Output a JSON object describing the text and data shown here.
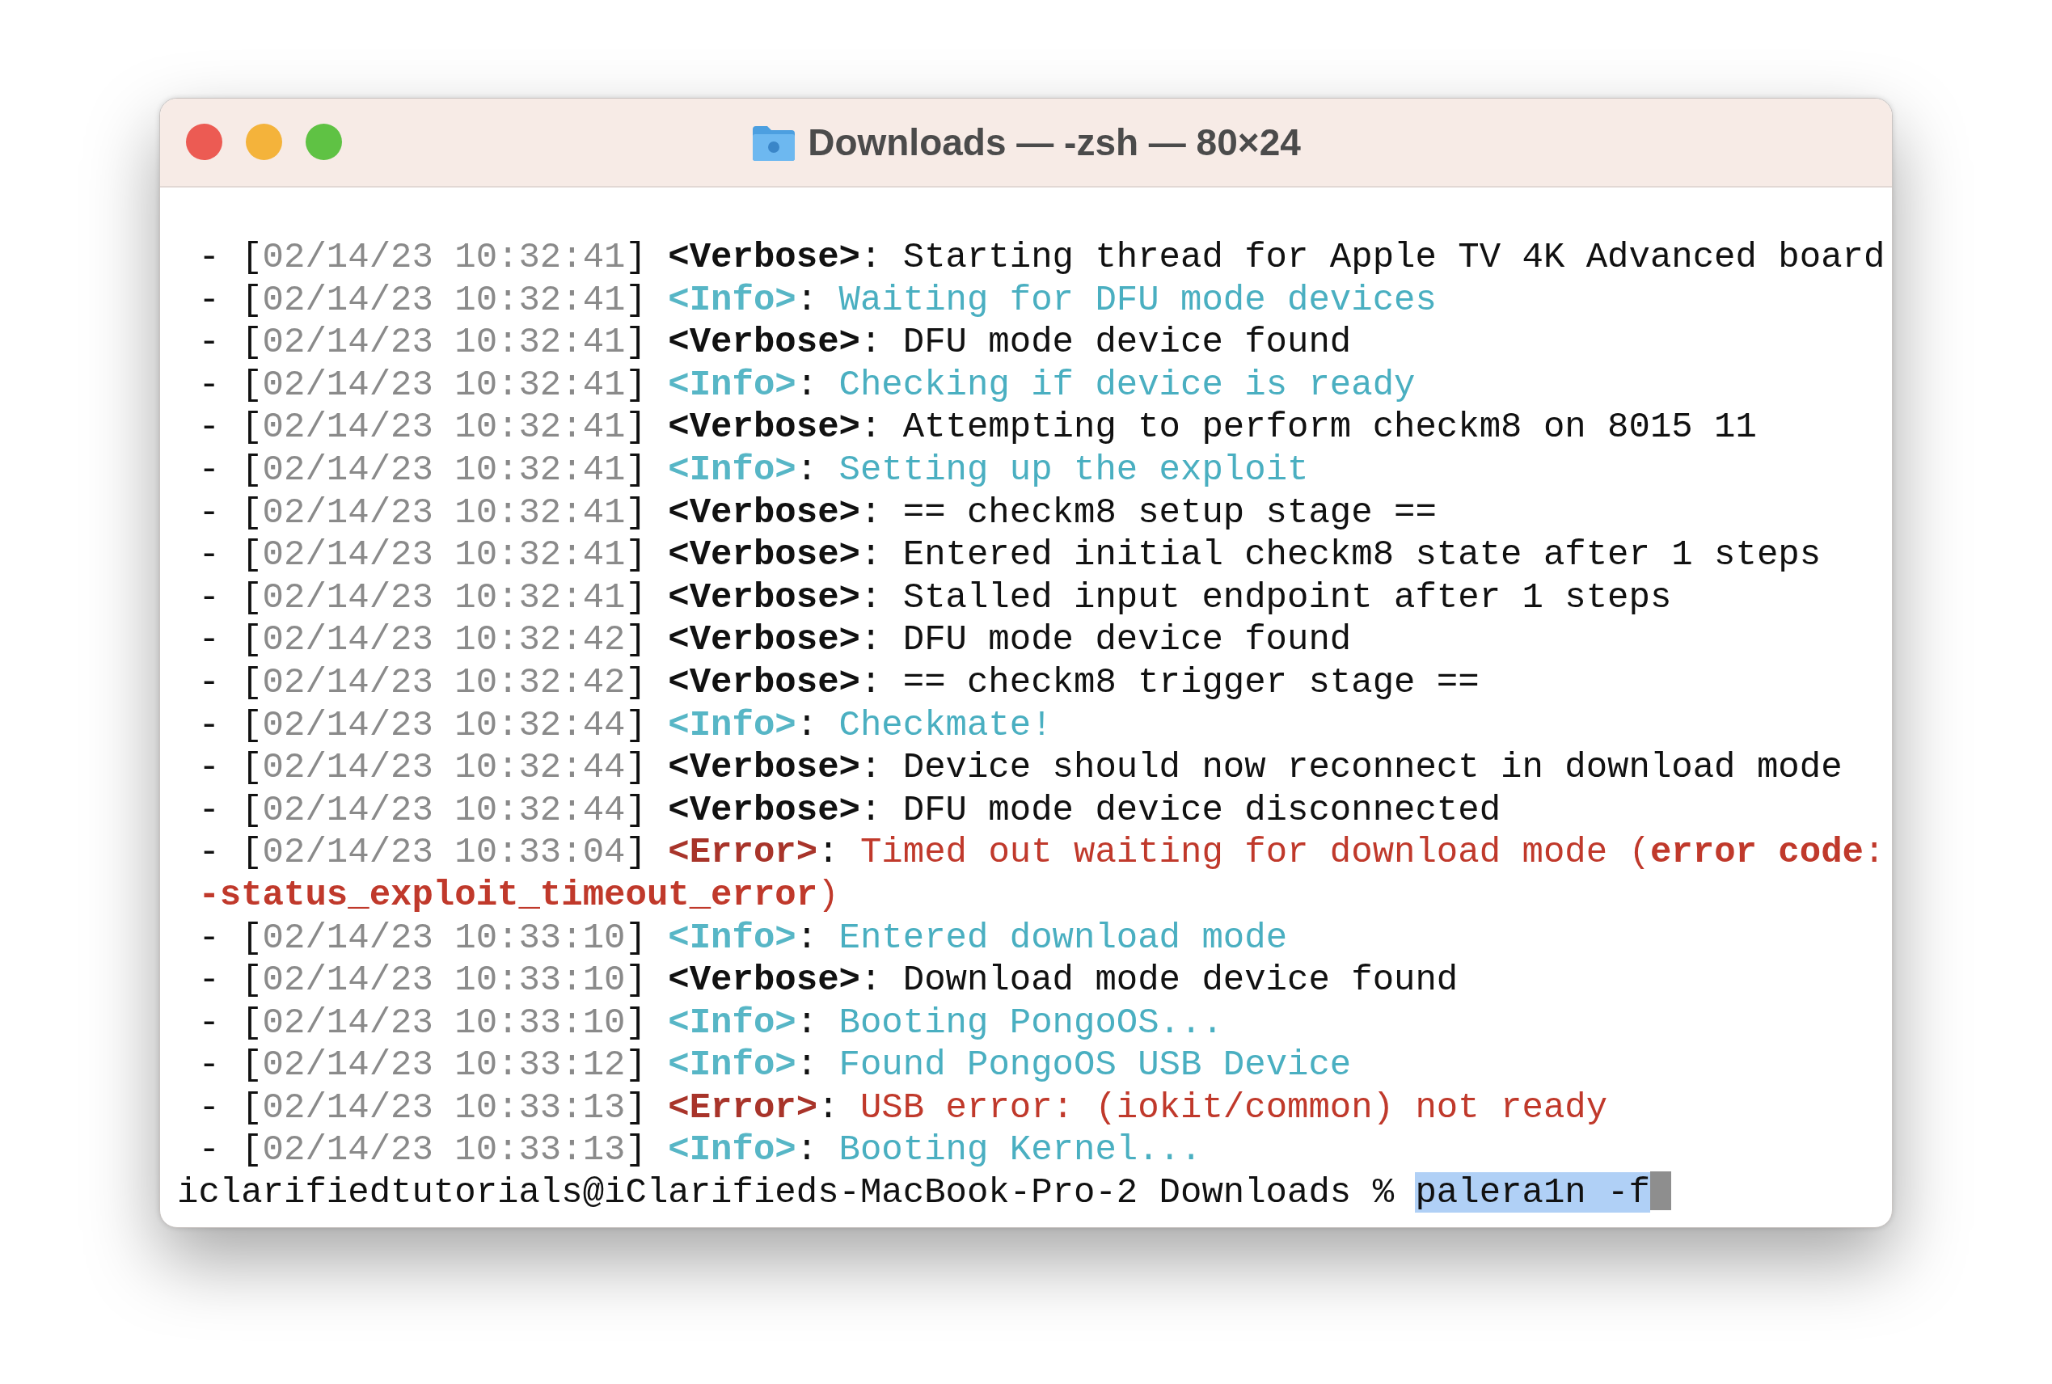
{
  "window": {
    "title": "Downloads — -zsh — 80×24"
  },
  "log": [
    {
      "kind": "verbose",
      "dash": "-",
      "timestamp": "[02/14/23 10:32:41]",
      "tag": "<Verbose>:",
      "message": "Starting thread for Apple TV 4K Advanced board"
    },
    {
      "kind": "info",
      "dash": "-",
      "timestamp": "[02/14/23 10:32:41]",
      "tag": "<Info>:",
      "message": "Waiting for DFU mode devices"
    },
    {
      "kind": "verbose",
      "dash": "-",
      "timestamp": "[02/14/23 10:32:41]",
      "tag": "<Verbose>:",
      "message": "DFU mode device found"
    },
    {
      "kind": "info",
      "dash": "-",
      "timestamp": "[02/14/23 10:32:41]",
      "tag": "<Info>:",
      "message": "Checking if device is ready"
    },
    {
      "kind": "verbose",
      "dash": "-",
      "timestamp": "[02/14/23 10:32:41]",
      "tag": "<Verbose>:",
      "message": "Attempting to perform checkm8 on 8015 11"
    },
    {
      "kind": "info",
      "dash": "-",
      "timestamp": "[02/14/23 10:32:41]",
      "tag": "<Info>:",
      "message": "Setting up the exploit"
    },
    {
      "kind": "verbose",
      "dash": "-",
      "timestamp": "[02/14/23 10:32:41]",
      "tag": "<Verbose>:",
      "message": "== checkm8 setup stage =="
    },
    {
      "kind": "verbose",
      "dash": "-",
      "timestamp": "[02/14/23 10:32:41]",
      "tag": "<Verbose>:",
      "message": "Entered initial checkm8 state after 1 steps"
    },
    {
      "kind": "verbose",
      "dash": "-",
      "timestamp": "[02/14/23 10:32:41]",
      "tag": "<Verbose>:",
      "message": "Stalled input endpoint after 1 steps"
    },
    {
      "kind": "verbose",
      "dash": "-",
      "timestamp": "[02/14/23 10:32:42]",
      "tag": "<Verbose>:",
      "message": "DFU mode device found"
    },
    {
      "kind": "verbose",
      "dash": "-",
      "timestamp": "[02/14/23 10:32:42]",
      "tag": "<Verbose>:",
      "message": "== checkm8 trigger stage =="
    },
    {
      "kind": "info",
      "dash": "-",
      "timestamp": "[02/14/23 10:32:44]",
      "tag": "<Info>:",
      "message": "Checkmate!"
    },
    {
      "kind": "verbose",
      "dash": "-",
      "timestamp": "[02/14/23 10:32:44]",
      "tag": "<Verbose>:",
      "message": "Device should now reconnect in download mode"
    },
    {
      "kind": "verbose",
      "dash": "-",
      "timestamp": "[02/14/23 10:32:44]",
      "tag": "<Verbose>:",
      "message": "DFU mode device disconnected"
    },
    {
      "kind": "error",
      "dash": "-",
      "timestamp": "[02/14/23 10:33:04]",
      "tag": "<Error>:",
      "message": "Timed out waiting for download mode (**error code**: **-status_exploit_timeout_error**)"
    },
    {
      "kind": "info",
      "dash": "-",
      "timestamp": "[02/14/23 10:33:10]",
      "tag": "<Info>:",
      "message": "Entered download mode"
    },
    {
      "kind": "verbose",
      "dash": "-",
      "timestamp": "[02/14/23 10:33:10]",
      "tag": "<Verbose>:",
      "message": "Download mode device found"
    },
    {
      "kind": "info",
      "dash": "-",
      "timestamp": "[02/14/23 10:33:10]",
      "tag": "<Info>:",
      "message": "Booting PongoOS..."
    },
    {
      "kind": "info",
      "dash": "-",
      "timestamp": "[02/14/23 10:33:12]",
      "tag": "<Info>:",
      "message": "Found PongoOS USB Device"
    },
    {
      "kind": "error",
      "dash": "-",
      "timestamp": "[02/14/23 10:33:13]",
      "tag": "<Error>:",
      "message": "USB error: (iokit/common) not ready"
    },
    {
      "kind": "info",
      "dash": "-",
      "timestamp": "[02/14/23 10:33:13]",
      "tag": "<Info>:",
      "message": "Booting Kernel..."
    }
  ],
  "prompt": {
    "text": "iclarifiedtutorials@iClarifieds-MacBook-Pro-2 Downloads %",
    "command": "palera1n -f",
    "selected": true
  }
}
